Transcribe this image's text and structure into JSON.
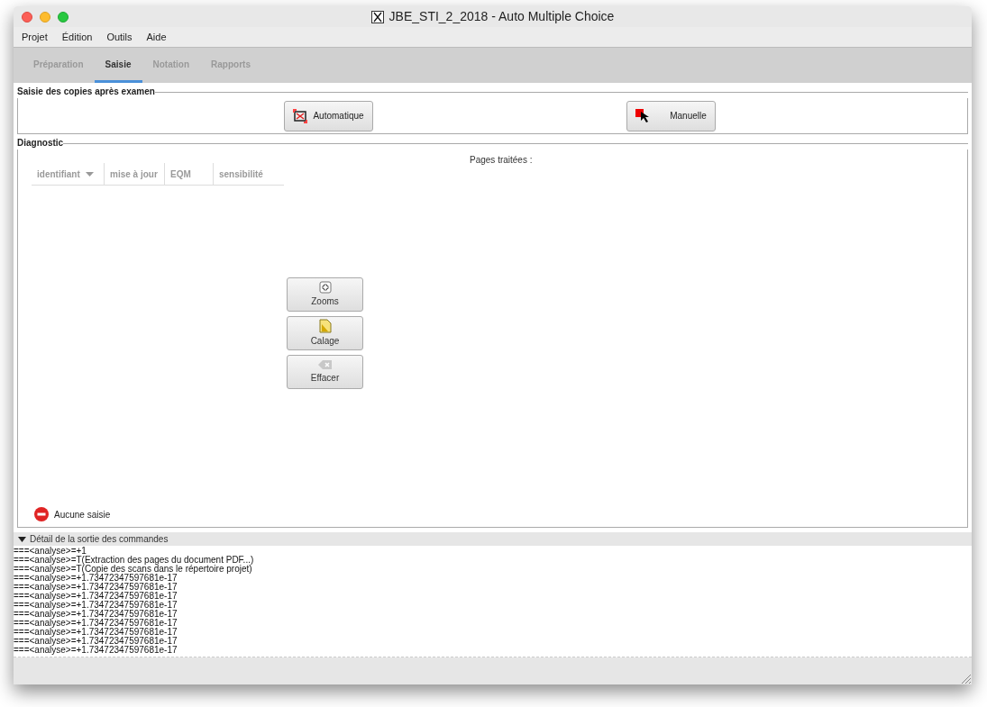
{
  "window": {
    "title": "JBE_STI_2_2018 - Auto Multiple Choice"
  },
  "menu": [
    "Projet",
    "Édition",
    "Outils",
    "Aide"
  ],
  "tabs": [
    {
      "label": "Préparation",
      "selected": false
    },
    {
      "label": "Saisie",
      "selected": true
    },
    {
      "label": "Notation",
      "selected": false
    },
    {
      "label": "Rapports",
      "selected": false
    }
  ],
  "saisie": {
    "title": "Saisie des copies après examen",
    "buttons": [
      {
        "kind": "auto",
        "label": "Automatique"
      },
      {
        "kind": "manual",
        "label": "Manuelle"
      }
    ]
  },
  "diagnostic": {
    "title": "Diagnostic",
    "columns": [
      "identifiant",
      "mise à jour",
      "EQM",
      "sensibilité"
    ],
    "pages_label": "Pages traitées :",
    "tools": [
      {
        "kind": "zoom",
        "label": "Zooms"
      },
      {
        "kind": "layout",
        "label": "Calage"
      },
      {
        "kind": "erase",
        "label": "Effacer"
      }
    ],
    "status": "Aucune saisie"
  },
  "log": {
    "title": "Détail de la sortie des commandes",
    "expanded": true,
    "lines": [
      "===<analyse>=+1",
      "===<analyse>=T(Extraction des pages du document PDF...)",
      "===<analyse>=T(Copie des scans dans le répertoire projet)",
      "===<analyse>=+1.73472347597681e-17",
      "===<analyse>=+1.73472347597681e-17",
      "===<analyse>=+1.73472347597681e-17",
      "===<analyse>=+1.73472347597681e-17",
      "===<analyse>=+1.73472347597681e-17",
      "===<analyse>=+1.73472347597681e-17",
      "===<analyse>=+1.73472347597681e-17",
      "===<analyse>=+1.73472347597681e-17",
      "===<analyse>=+1.73472347597681e-17"
    ]
  }
}
